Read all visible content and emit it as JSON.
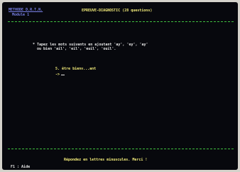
{
  "header": {
    "program": "METHODE D.R.T.N.",
    "module": "Module 1",
    "title": "EPREUVE-DIAGNOSTIC (28 questions)"
  },
  "instructions": {
    "line1": "* Tapez les mots suivants en ajoutant 'ay', 'ey', 'ay'",
    "line2": "  ou bien 'ail', 'eil', 'euil', 'ouil'."
  },
  "question": {
    "text": "5. être bienv...ant",
    "prompt": "->"
  },
  "footer": {
    "message": "Répondez en lettres minuscules. Merci !",
    "f1_help": "F1 : Aide"
  }
}
